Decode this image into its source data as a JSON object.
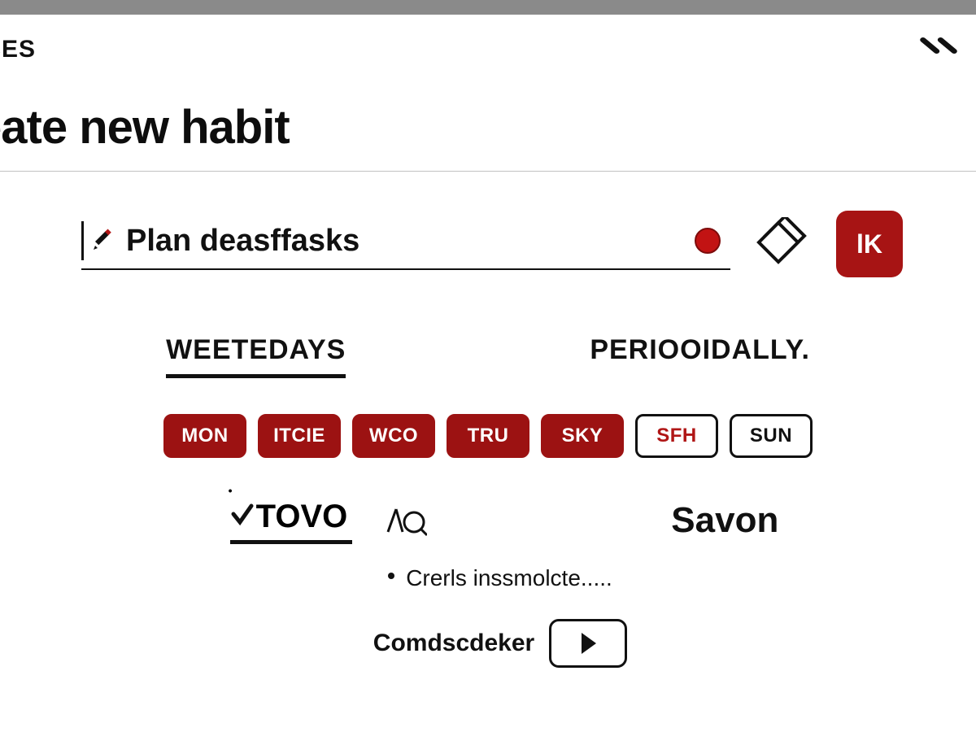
{
  "colors": {
    "accent": "#a71414",
    "text": "#111111"
  },
  "header": {
    "nav_fragment": "ICES"
  },
  "title": "eate new habit",
  "name_field": {
    "value": "Plan deasffasks"
  },
  "action_button": {
    "label": "lK"
  },
  "tabs": {
    "weekdays": "WEETEDAYS",
    "periodically": "PERIOOIDALLY.",
    "active": "weekdays"
  },
  "days": [
    {
      "label": "MON",
      "selected": true
    },
    {
      "label": "ITCIE",
      "selected": true
    },
    {
      "label": "WCO",
      "selected": true
    },
    {
      "label": "TRU",
      "selected": true
    },
    {
      "label": "SKY",
      "selected": true
    },
    {
      "label": "SFH",
      "selected": false,
      "variant": "sat"
    },
    {
      "label": "SUN",
      "selected": false
    }
  ],
  "sub": {
    "option_a": "TOVO",
    "option_b": "AQ",
    "save": "Savon"
  },
  "hint": "Crerls inssmolcte.....",
  "picker": {
    "label": "Comdscdeker"
  }
}
